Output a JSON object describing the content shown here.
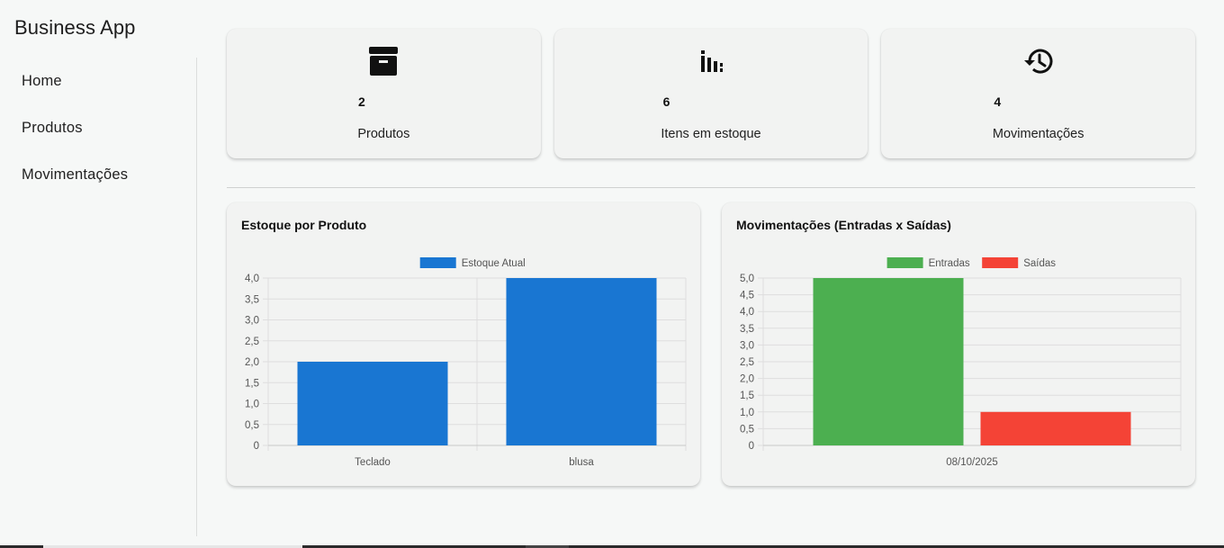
{
  "app": {
    "title": "Business App"
  },
  "sidebar": {
    "items": [
      {
        "label": "Home"
      },
      {
        "label": "Produtos"
      },
      {
        "label": "Movimentações"
      }
    ]
  },
  "kpis": [
    {
      "icon": "archive-box-icon",
      "value": "2",
      "label": "Produtos"
    },
    {
      "icon": "bar-chart-icon",
      "value": "6",
      "label": "Itens em estoque"
    },
    {
      "icon": "history-icon",
      "value": "4",
      "label": "Movimentações"
    }
  ],
  "colors": {
    "blue": "#1976d2",
    "green": "#4caf50",
    "red": "#f44336"
  },
  "chart_data": [
    {
      "type": "bar",
      "title": "Estoque por Produto",
      "categories": [
        "Teclado",
        "blusa"
      ],
      "series": [
        {
          "name": "Estoque Atual",
          "values": [
            2,
            4
          ],
          "color": "#1976d2"
        }
      ],
      "ylim": [
        0,
        4
      ],
      "yticks": [
        "4,0",
        "3,5",
        "3,0",
        "2,5",
        "2,0",
        "1,5",
        "1,0",
        "0,5",
        "0"
      ],
      "legend": "top-center",
      "grid": true
    },
    {
      "type": "bar",
      "title": "Movimentações (Entradas x Saídas)",
      "categories": [
        "08/10/2025"
      ],
      "series": [
        {
          "name": "Entradas",
          "values": [
            5
          ],
          "color": "#4caf50"
        },
        {
          "name": "Saídas",
          "values": [
            1
          ],
          "color": "#f44336"
        }
      ],
      "ylim": [
        0,
        5
      ],
      "yticks": [
        "5,0",
        "4,5",
        "4,0",
        "3,5",
        "3,0",
        "2,5",
        "2,0",
        "1,5",
        "1,0",
        "0,5",
        "0"
      ],
      "legend": "top-center",
      "grid": true
    }
  ]
}
